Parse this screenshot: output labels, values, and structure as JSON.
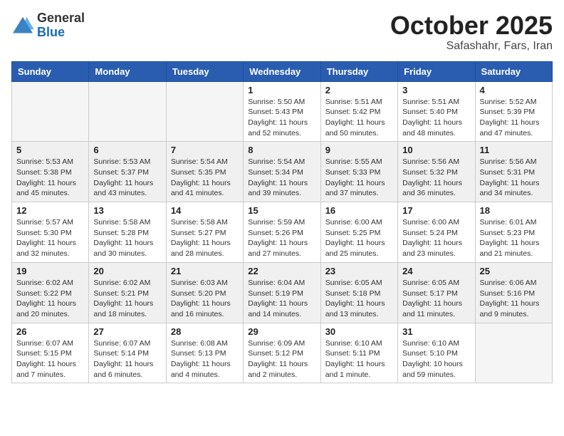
{
  "header": {
    "logo_general": "General",
    "logo_blue": "Blue",
    "month_title": "October 2025",
    "subtitle": "Safashahr, Fars, Iran"
  },
  "weekdays": [
    "Sunday",
    "Monday",
    "Tuesday",
    "Wednesday",
    "Thursday",
    "Friday",
    "Saturday"
  ],
  "rows": [
    {
      "shaded": false,
      "days": [
        {
          "num": "",
          "info": ""
        },
        {
          "num": "",
          "info": ""
        },
        {
          "num": "",
          "info": ""
        },
        {
          "num": "1",
          "info": "Sunrise: 5:50 AM\nSunset: 5:43 PM\nDaylight: 11 hours\nand 52 minutes."
        },
        {
          "num": "2",
          "info": "Sunrise: 5:51 AM\nSunset: 5:42 PM\nDaylight: 11 hours\nand 50 minutes."
        },
        {
          "num": "3",
          "info": "Sunrise: 5:51 AM\nSunset: 5:40 PM\nDaylight: 11 hours\nand 48 minutes."
        },
        {
          "num": "4",
          "info": "Sunrise: 5:52 AM\nSunset: 5:39 PM\nDaylight: 11 hours\nand 47 minutes."
        }
      ]
    },
    {
      "shaded": true,
      "days": [
        {
          "num": "5",
          "info": "Sunrise: 5:53 AM\nSunset: 5:38 PM\nDaylight: 11 hours\nand 45 minutes."
        },
        {
          "num": "6",
          "info": "Sunrise: 5:53 AM\nSunset: 5:37 PM\nDaylight: 11 hours\nand 43 minutes."
        },
        {
          "num": "7",
          "info": "Sunrise: 5:54 AM\nSunset: 5:35 PM\nDaylight: 11 hours\nand 41 minutes."
        },
        {
          "num": "8",
          "info": "Sunrise: 5:54 AM\nSunset: 5:34 PM\nDaylight: 11 hours\nand 39 minutes."
        },
        {
          "num": "9",
          "info": "Sunrise: 5:55 AM\nSunset: 5:33 PM\nDaylight: 11 hours\nand 37 minutes."
        },
        {
          "num": "10",
          "info": "Sunrise: 5:56 AM\nSunset: 5:32 PM\nDaylight: 11 hours\nand 36 minutes."
        },
        {
          "num": "11",
          "info": "Sunrise: 5:56 AM\nSunset: 5:31 PM\nDaylight: 11 hours\nand 34 minutes."
        }
      ]
    },
    {
      "shaded": false,
      "days": [
        {
          "num": "12",
          "info": "Sunrise: 5:57 AM\nSunset: 5:30 PM\nDaylight: 11 hours\nand 32 minutes."
        },
        {
          "num": "13",
          "info": "Sunrise: 5:58 AM\nSunset: 5:28 PM\nDaylight: 11 hours\nand 30 minutes."
        },
        {
          "num": "14",
          "info": "Sunrise: 5:58 AM\nSunset: 5:27 PM\nDaylight: 11 hours\nand 28 minutes."
        },
        {
          "num": "15",
          "info": "Sunrise: 5:59 AM\nSunset: 5:26 PM\nDaylight: 11 hours\nand 27 minutes."
        },
        {
          "num": "16",
          "info": "Sunrise: 6:00 AM\nSunset: 5:25 PM\nDaylight: 11 hours\nand 25 minutes."
        },
        {
          "num": "17",
          "info": "Sunrise: 6:00 AM\nSunset: 5:24 PM\nDaylight: 11 hours\nand 23 minutes."
        },
        {
          "num": "18",
          "info": "Sunrise: 6:01 AM\nSunset: 5:23 PM\nDaylight: 11 hours\nand 21 minutes."
        }
      ]
    },
    {
      "shaded": true,
      "days": [
        {
          "num": "19",
          "info": "Sunrise: 6:02 AM\nSunset: 5:22 PM\nDaylight: 11 hours\nand 20 minutes."
        },
        {
          "num": "20",
          "info": "Sunrise: 6:02 AM\nSunset: 5:21 PM\nDaylight: 11 hours\nand 18 minutes."
        },
        {
          "num": "21",
          "info": "Sunrise: 6:03 AM\nSunset: 5:20 PM\nDaylight: 11 hours\nand 16 minutes."
        },
        {
          "num": "22",
          "info": "Sunrise: 6:04 AM\nSunset: 5:19 PM\nDaylight: 11 hours\nand 14 minutes."
        },
        {
          "num": "23",
          "info": "Sunrise: 6:05 AM\nSunset: 5:18 PM\nDaylight: 11 hours\nand 13 minutes."
        },
        {
          "num": "24",
          "info": "Sunrise: 6:05 AM\nSunset: 5:17 PM\nDaylight: 11 hours\nand 11 minutes."
        },
        {
          "num": "25",
          "info": "Sunrise: 6:06 AM\nSunset: 5:16 PM\nDaylight: 11 hours\nand 9 minutes."
        }
      ]
    },
    {
      "shaded": false,
      "days": [
        {
          "num": "26",
          "info": "Sunrise: 6:07 AM\nSunset: 5:15 PM\nDaylight: 11 hours\nand 7 minutes."
        },
        {
          "num": "27",
          "info": "Sunrise: 6:07 AM\nSunset: 5:14 PM\nDaylight: 11 hours\nand 6 minutes."
        },
        {
          "num": "28",
          "info": "Sunrise: 6:08 AM\nSunset: 5:13 PM\nDaylight: 11 hours\nand 4 minutes."
        },
        {
          "num": "29",
          "info": "Sunrise: 6:09 AM\nSunset: 5:12 PM\nDaylight: 11 hours\nand 2 minutes."
        },
        {
          "num": "30",
          "info": "Sunrise: 6:10 AM\nSunset: 5:11 PM\nDaylight: 11 hours\nand 1 minute."
        },
        {
          "num": "31",
          "info": "Sunrise: 6:10 AM\nSunset: 5:10 PM\nDaylight: 10 hours\nand 59 minutes."
        },
        {
          "num": "",
          "info": ""
        }
      ]
    }
  ]
}
